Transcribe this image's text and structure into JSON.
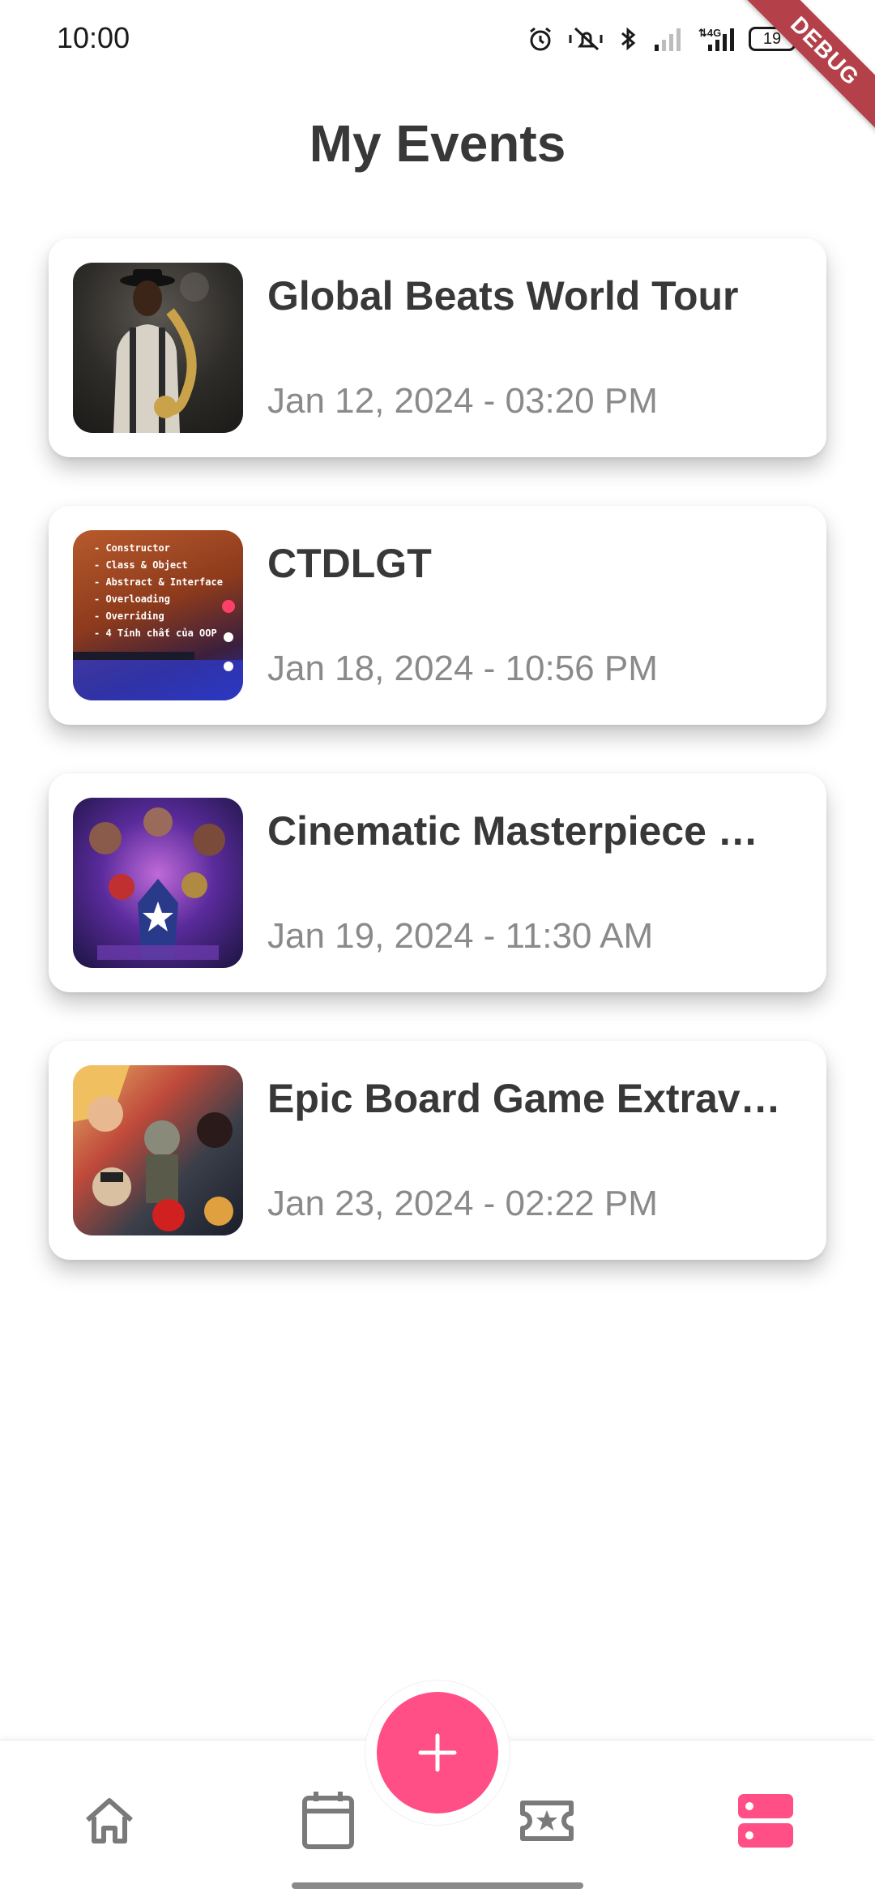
{
  "status_bar": {
    "time": "10:00",
    "battery": "19",
    "icons": [
      "alarm-icon",
      "mute-icon",
      "bluetooth-icon",
      "signal-icon",
      "4g-signal-icon",
      "battery-icon",
      "charging-icon"
    ]
  },
  "debug_banner": "DEBUG",
  "title": "My Events",
  "events": [
    {
      "title": "Global Beats World Tour",
      "date": "Jan 12, 2024 - 03:20 PM"
    },
    {
      "title": "CTDLGT",
      "date": "Jan 18, 2024 - 10:56 PM",
      "thumb_text": [
        "- Constructor",
        "- Class & Object",
        "- Abstract & Interface",
        "- Overloading",
        "- Overriding",
        "- 4 Tính chất của OOP"
      ]
    },
    {
      "title": "Cinematic Masterpiece …",
      "date": "Jan 19, 2024 - 11:30 AM"
    },
    {
      "title": "Epic Board Game Extrav…",
      "date": "Jan 23, 2024 - 02:22 PM"
    }
  ],
  "bottom_nav": {
    "items": [
      "home-icon",
      "calendar-icon",
      "ticket-icon",
      "list-icon"
    ],
    "active": "list-icon",
    "fab_icon": "plus-icon"
  },
  "colors": {
    "accent": "#ff4f86",
    "title_text": "#383838",
    "date_text": "#8a8a8a",
    "inactive_icon": "#7a7a7a",
    "debug_ribbon": "#b4414a"
  }
}
